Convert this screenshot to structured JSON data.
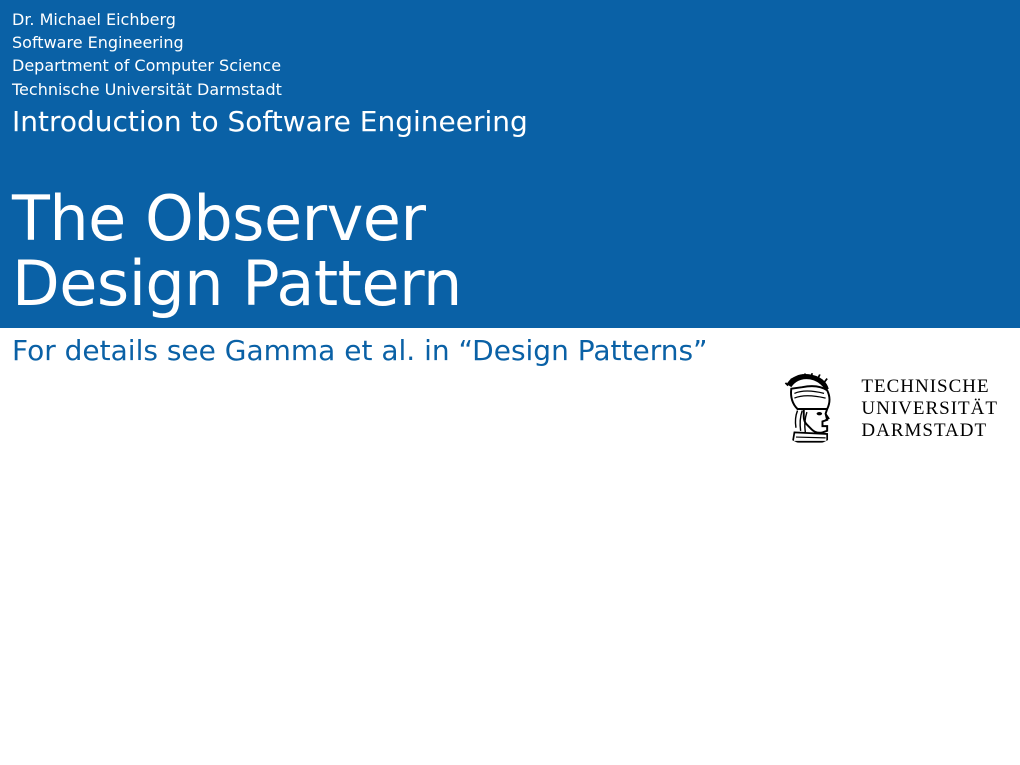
{
  "header": {
    "author": "Dr. Michael Eichberg",
    "chair": "Software Engineering",
    "department": "Department of Computer Science",
    "university": "Technische Universität Darmstadt",
    "course_title": "Introduction to Software Engineering",
    "main_title_line1": "The Observer",
    "main_title_line2": "Design Pattern"
  },
  "subtitle": "For details see Gamma et al. in “Design Patterns”",
  "logo": {
    "text_line1": "TECHNISCHE",
    "text_line2": "UNIVERSITÄT",
    "text_line3": "DARMSTADT"
  },
  "colors": {
    "brand_blue": "#0a61a6",
    "white": "#ffffff",
    "black": "#000000"
  }
}
